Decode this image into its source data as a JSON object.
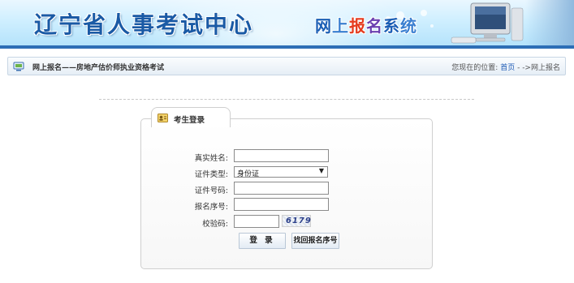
{
  "banner": {
    "site_title": "辽宁省人事考试中心",
    "system_title_parts": [
      "网",
      "上",
      "报",
      "名",
      "系",
      "统"
    ]
  },
  "breadcrumb": {
    "title": "网上报名——房地产估价师执业资格考试",
    "location_prefix": "您现在的位置:",
    "home_link": "首页",
    "separator": "->",
    "current": "网上报名"
  },
  "login": {
    "tab_label": "考生登录",
    "fields": {
      "name": {
        "label": "真实姓名:",
        "value": ""
      },
      "id_type": {
        "label": "证件类型:",
        "selected": "身份证"
      },
      "id_number": {
        "label": "证件号码:",
        "value": ""
      },
      "reg_number": {
        "label": "报名序号:",
        "value": ""
      },
      "captcha": {
        "label": "校验码:",
        "value": "",
        "image_text": "6179"
      }
    },
    "login_button": "登 录",
    "retrieve_button": "找回报名序号"
  },
  "colors": {
    "banner_blue": "#1a5aa5",
    "link_blue": "#1e5bb5",
    "panel_border": "#cfcfcf"
  },
  "icons": {
    "crumb": "monitor-icon",
    "tab": "user-card-icon",
    "select": "dropdown-arrow-icon"
  }
}
